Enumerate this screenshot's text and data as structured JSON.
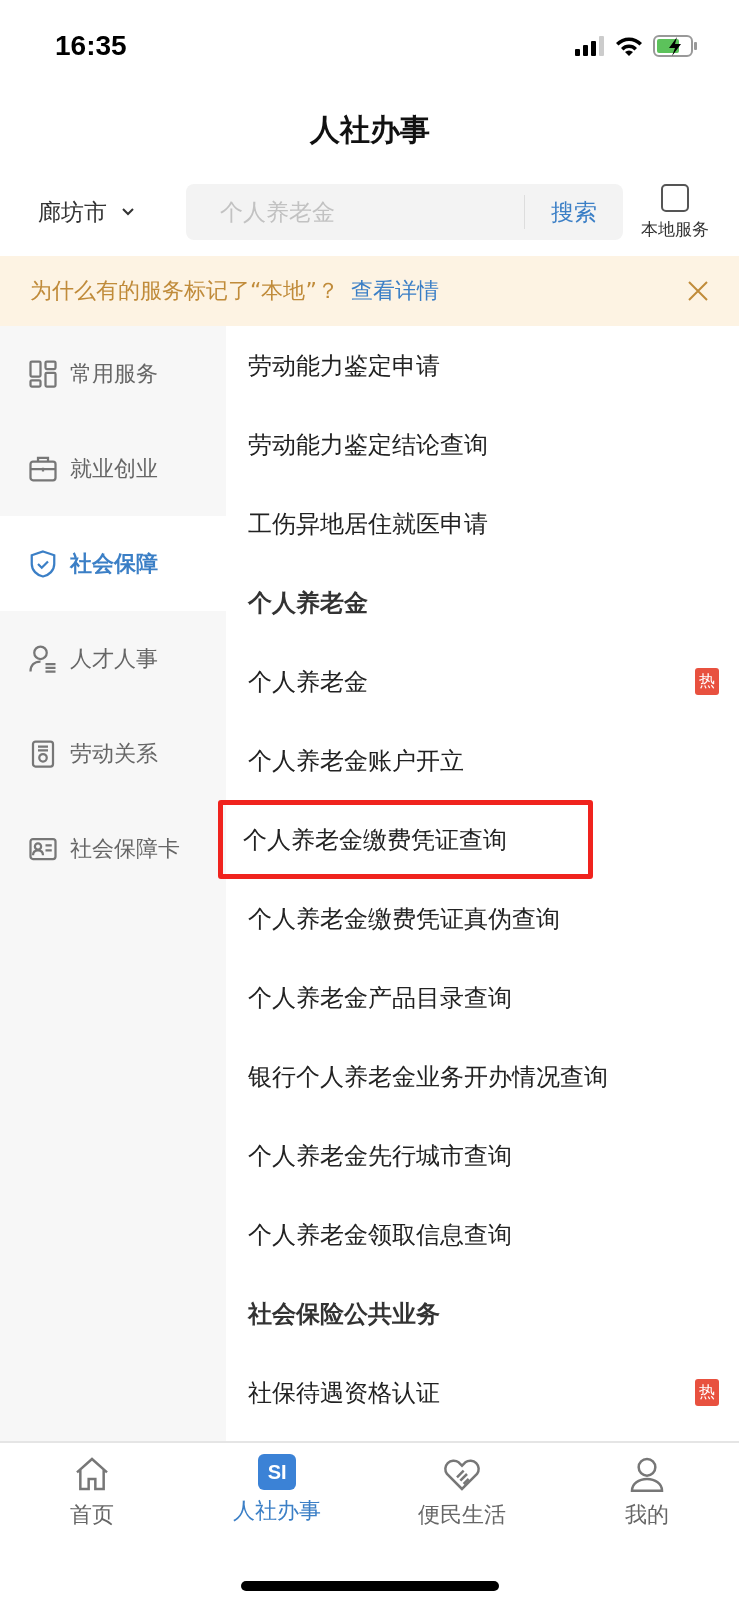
{
  "status_bar": {
    "time": "16:35"
  },
  "title": "人社办事",
  "search_row": {
    "city": "廊坊市",
    "placeholder": "个人养老金",
    "search_button": "搜索",
    "local_service": {
      "label": "本地服务",
      "checked": false
    }
  },
  "notice": {
    "text": "为什么有的服务标记了“本地”？",
    "link": "查看详情"
  },
  "sidebar": [
    {
      "label": "常用服务",
      "selected": false
    },
    {
      "label": "就业创业",
      "selected": false
    },
    {
      "label": "社会保障",
      "selected": true
    },
    {
      "label": "人才人事",
      "selected": false
    },
    {
      "label": "劳动关系",
      "selected": false
    },
    {
      "label": "社会保障卡",
      "selected": false
    }
  ],
  "services": [
    {
      "kind": "item",
      "label": "劳动能力鉴定申请",
      "hot": false,
      "highlighted": false
    },
    {
      "kind": "item",
      "label": "劳动能力鉴定结论查询",
      "hot": false,
      "highlighted": false
    },
    {
      "kind": "item",
      "label": "工伤异地居住就医申请",
      "hot": false,
      "highlighted": false
    },
    {
      "kind": "header",
      "label": "个人养老金"
    },
    {
      "kind": "item",
      "label": "个人养老金",
      "hot": true,
      "badge": "热",
      "highlighted": false
    },
    {
      "kind": "item",
      "label": "个人养老金账户开立",
      "hot": false,
      "highlighted": false
    },
    {
      "kind": "item",
      "label": "个人养老金缴费凭证查询",
      "hot": false,
      "highlighted": true
    },
    {
      "kind": "item",
      "label": "个人养老金缴费凭证真伪查询",
      "hot": false,
      "highlighted": false
    },
    {
      "kind": "item",
      "label": "个人养老金产品目录查询",
      "hot": false,
      "highlighted": false
    },
    {
      "kind": "item",
      "label": "银行个人养老金业务开办情况查询",
      "hot": false,
      "highlighted": false
    },
    {
      "kind": "item",
      "label": "个人养老金先行城市查询",
      "hot": false,
      "highlighted": false
    },
    {
      "kind": "item",
      "label": "个人养老金领取信息查询",
      "hot": false,
      "highlighted": false
    },
    {
      "kind": "header",
      "label": "社会保险公共业务"
    },
    {
      "kind": "item",
      "label": "社保待遇资格认证",
      "hot": true,
      "badge": "热",
      "highlighted": false
    }
  ],
  "tab_bar": [
    {
      "label": "首页",
      "selected": false
    },
    {
      "label": "人社办事",
      "icon_text": "SI",
      "selected": true
    },
    {
      "label": "便民生活",
      "selected": false
    },
    {
      "label": "我的",
      "selected": false
    }
  ]
}
